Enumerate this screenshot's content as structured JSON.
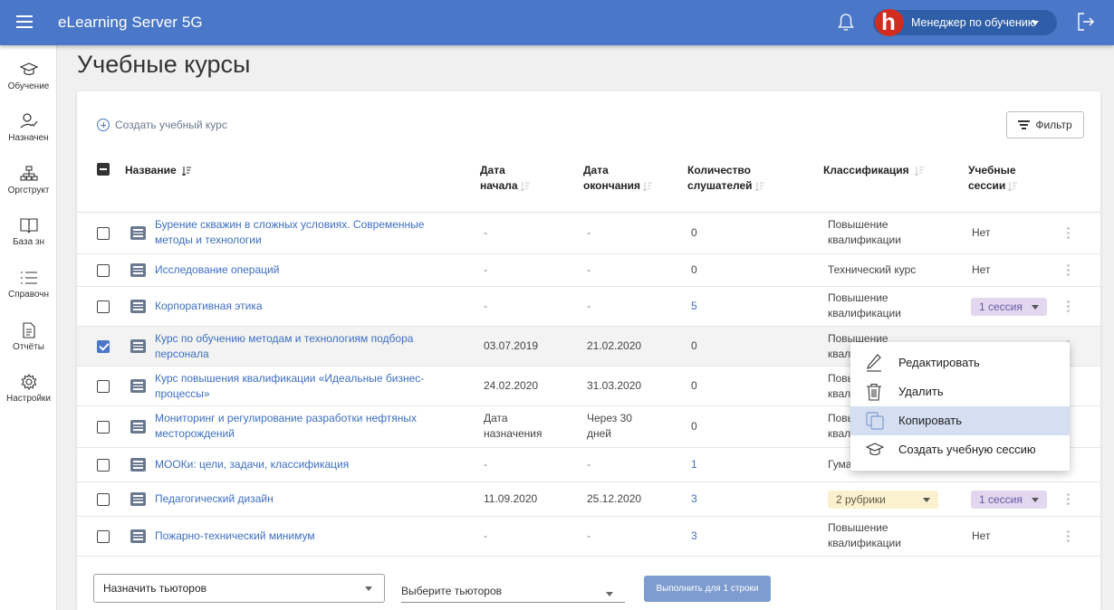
{
  "topbar": {
    "app_title": "eLearning Server 5G",
    "role": "Менеджер по обучению",
    "avatar_letter": "h"
  },
  "sidebar": {
    "items": [
      {
        "label": "Обучение",
        "icon": "graduation-cap-icon"
      },
      {
        "label": "Назначен",
        "icon": "user-check-icon"
      },
      {
        "label": "Оргструкт",
        "icon": "org-chart-icon"
      },
      {
        "label": "База зн",
        "icon": "book-icon"
      },
      {
        "label": "Справочн",
        "icon": "list-icon"
      },
      {
        "label": "Отчёты",
        "icon": "document-icon"
      },
      {
        "label": "Настройки",
        "icon": "gear-icon"
      }
    ]
  },
  "page": {
    "title": "Учебные курсы",
    "create_label": "Создать учебный курс",
    "filter_label": "Фильтр"
  },
  "table": {
    "headers": {
      "name": "Название",
      "start_1": "Дата",
      "start_2": "начала",
      "end_1": "Дата",
      "end_2": "окончания",
      "count_1": "Количество",
      "count_2": "слушателей",
      "classification": "Классификация",
      "sessions_1": "Учебные",
      "sessions_2": "сессии"
    },
    "rows": [
      {
        "name_1": "Бурение скважин в сложных условиях. Современные",
        "name_2": "методы и технологии",
        "start_1": "-",
        "start_2": "",
        "end_1": "-",
        "end_2": "",
        "count": "0",
        "class_1": "Повышение",
        "class_2": "квалификации",
        "sessions": "Нет",
        "checked": false
      },
      {
        "name_1": "Исследование операций",
        "name_2": "",
        "start_1": "-",
        "start_2": "",
        "end_1": "-",
        "end_2": "",
        "count": "0",
        "class_1": "Технический курс",
        "class_2": "",
        "sessions": "Нет",
        "checked": false
      },
      {
        "name_1": "Корпоративная этика",
        "name_2": "",
        "start_1": "-",
        "start_2": "",
        "end_1": "-",
        "end_2": "",
        "count": "5",
        "class_1": "Повышение",
        "class_2": "квалификации",
        "sessions": "1 сессия",
        "checked": false
      },
      {
        "name_1": "Курс по обучению методам и технологиям подбора",
        "name_2": "персонала",
        "start_1": "03.07.2019",
        "start_2": "",
        "end_1": "21.02.2020",
        "end_2": "",
        "count": "0",
        "class_1": "Повышение",
        "class_2": "квал",
        "sessions": "",
        "checked": true
      },
      {
        "name_1": "Курс повышения квалификации «Идеальные бизнес-",
        "name_2": "процессы»",
        "start_1": "24.02.2020",
        "start_2": "",
        "end_1": "31.03.2020",
        "end_2": "",
        "count": "0",
        "class_1": "Повыш",
        "class_2": "квал",
        "sessions": "",
        "checked": false
      },
      {
        "name_1": "Мониторинг и регулирование разработки нефтяных",
        "name_2": "месторождений",
        "start_1": "Дата",
        "start_2": "назначения",
        "end_1": "Через 30",
        "end_2": "дней",
        "count": "0",
        "class_1": "Повы",
        "class_2": "квал",
        "sessions": "",
        "checked": false
      },
      {
        "name_1": "МООКи: цели, задачи, классификация",
        "name_2": "",
        "start_1": "-",
        "start_2": "",
        "end_1": "-",
        "end_2": "",
        "count": "1",
        "class_1": "Гума",
        "class_2": "",
        "sessions": "",
        "checked": false
      },
      {
        "name_1": "Педагогический дизайн",
        "name_2": "",
        "start_1": "11.09.2020",
        "start_2": "",
        "end_1": "25.12.2020",
        "end_2": "",
        "count": "3",
        "class_1": "2 рубрики",
        "class_2": "",
        "sessions": "1 сессия",
        "checked": false
      },
      {
        "name_1": "Пожарно-технический минимум",
        "name_2": "",
        "start_1": "-",
        "start_2": "",
        "end_1": "-",
        "end_2": "",
        "count": "3",
        "class_1": "Повышение",
        "class_2": "квалификации",
        "sessions": "Нет",
        "checked": false
      }
    ]
  },
  "bottom": {
    "assign_value": "Назначить тьюторов",
    "tutor_placeholder": "Выберите тьюторов",
    "exec_label": "Выполнить для 1 строки"
  },
  "context_menu": {
    "items": [
      {
        "label": "Редактировать",
        "icon": "pencil-icon"
      },
      {
        "label": "Удалить",
        "icon": "trash-icon"
      },
      {
        "label": "Копировать",
        "icon": "copy-icon"
      },
      {
        "label": "Создать учебную сессию",
        "icon": "graduation-cap-icon"
      }
    ],
    "active_index": 2
  },
  "colors": {
    "topbar": "#4a77c8",
    "link": "#3d6fc2",
    "chip_purple": "#e2d7ef",
    "chip_yellow": "#fcf1cf",
    "menu_active": "#d6dff2"
  }
}
